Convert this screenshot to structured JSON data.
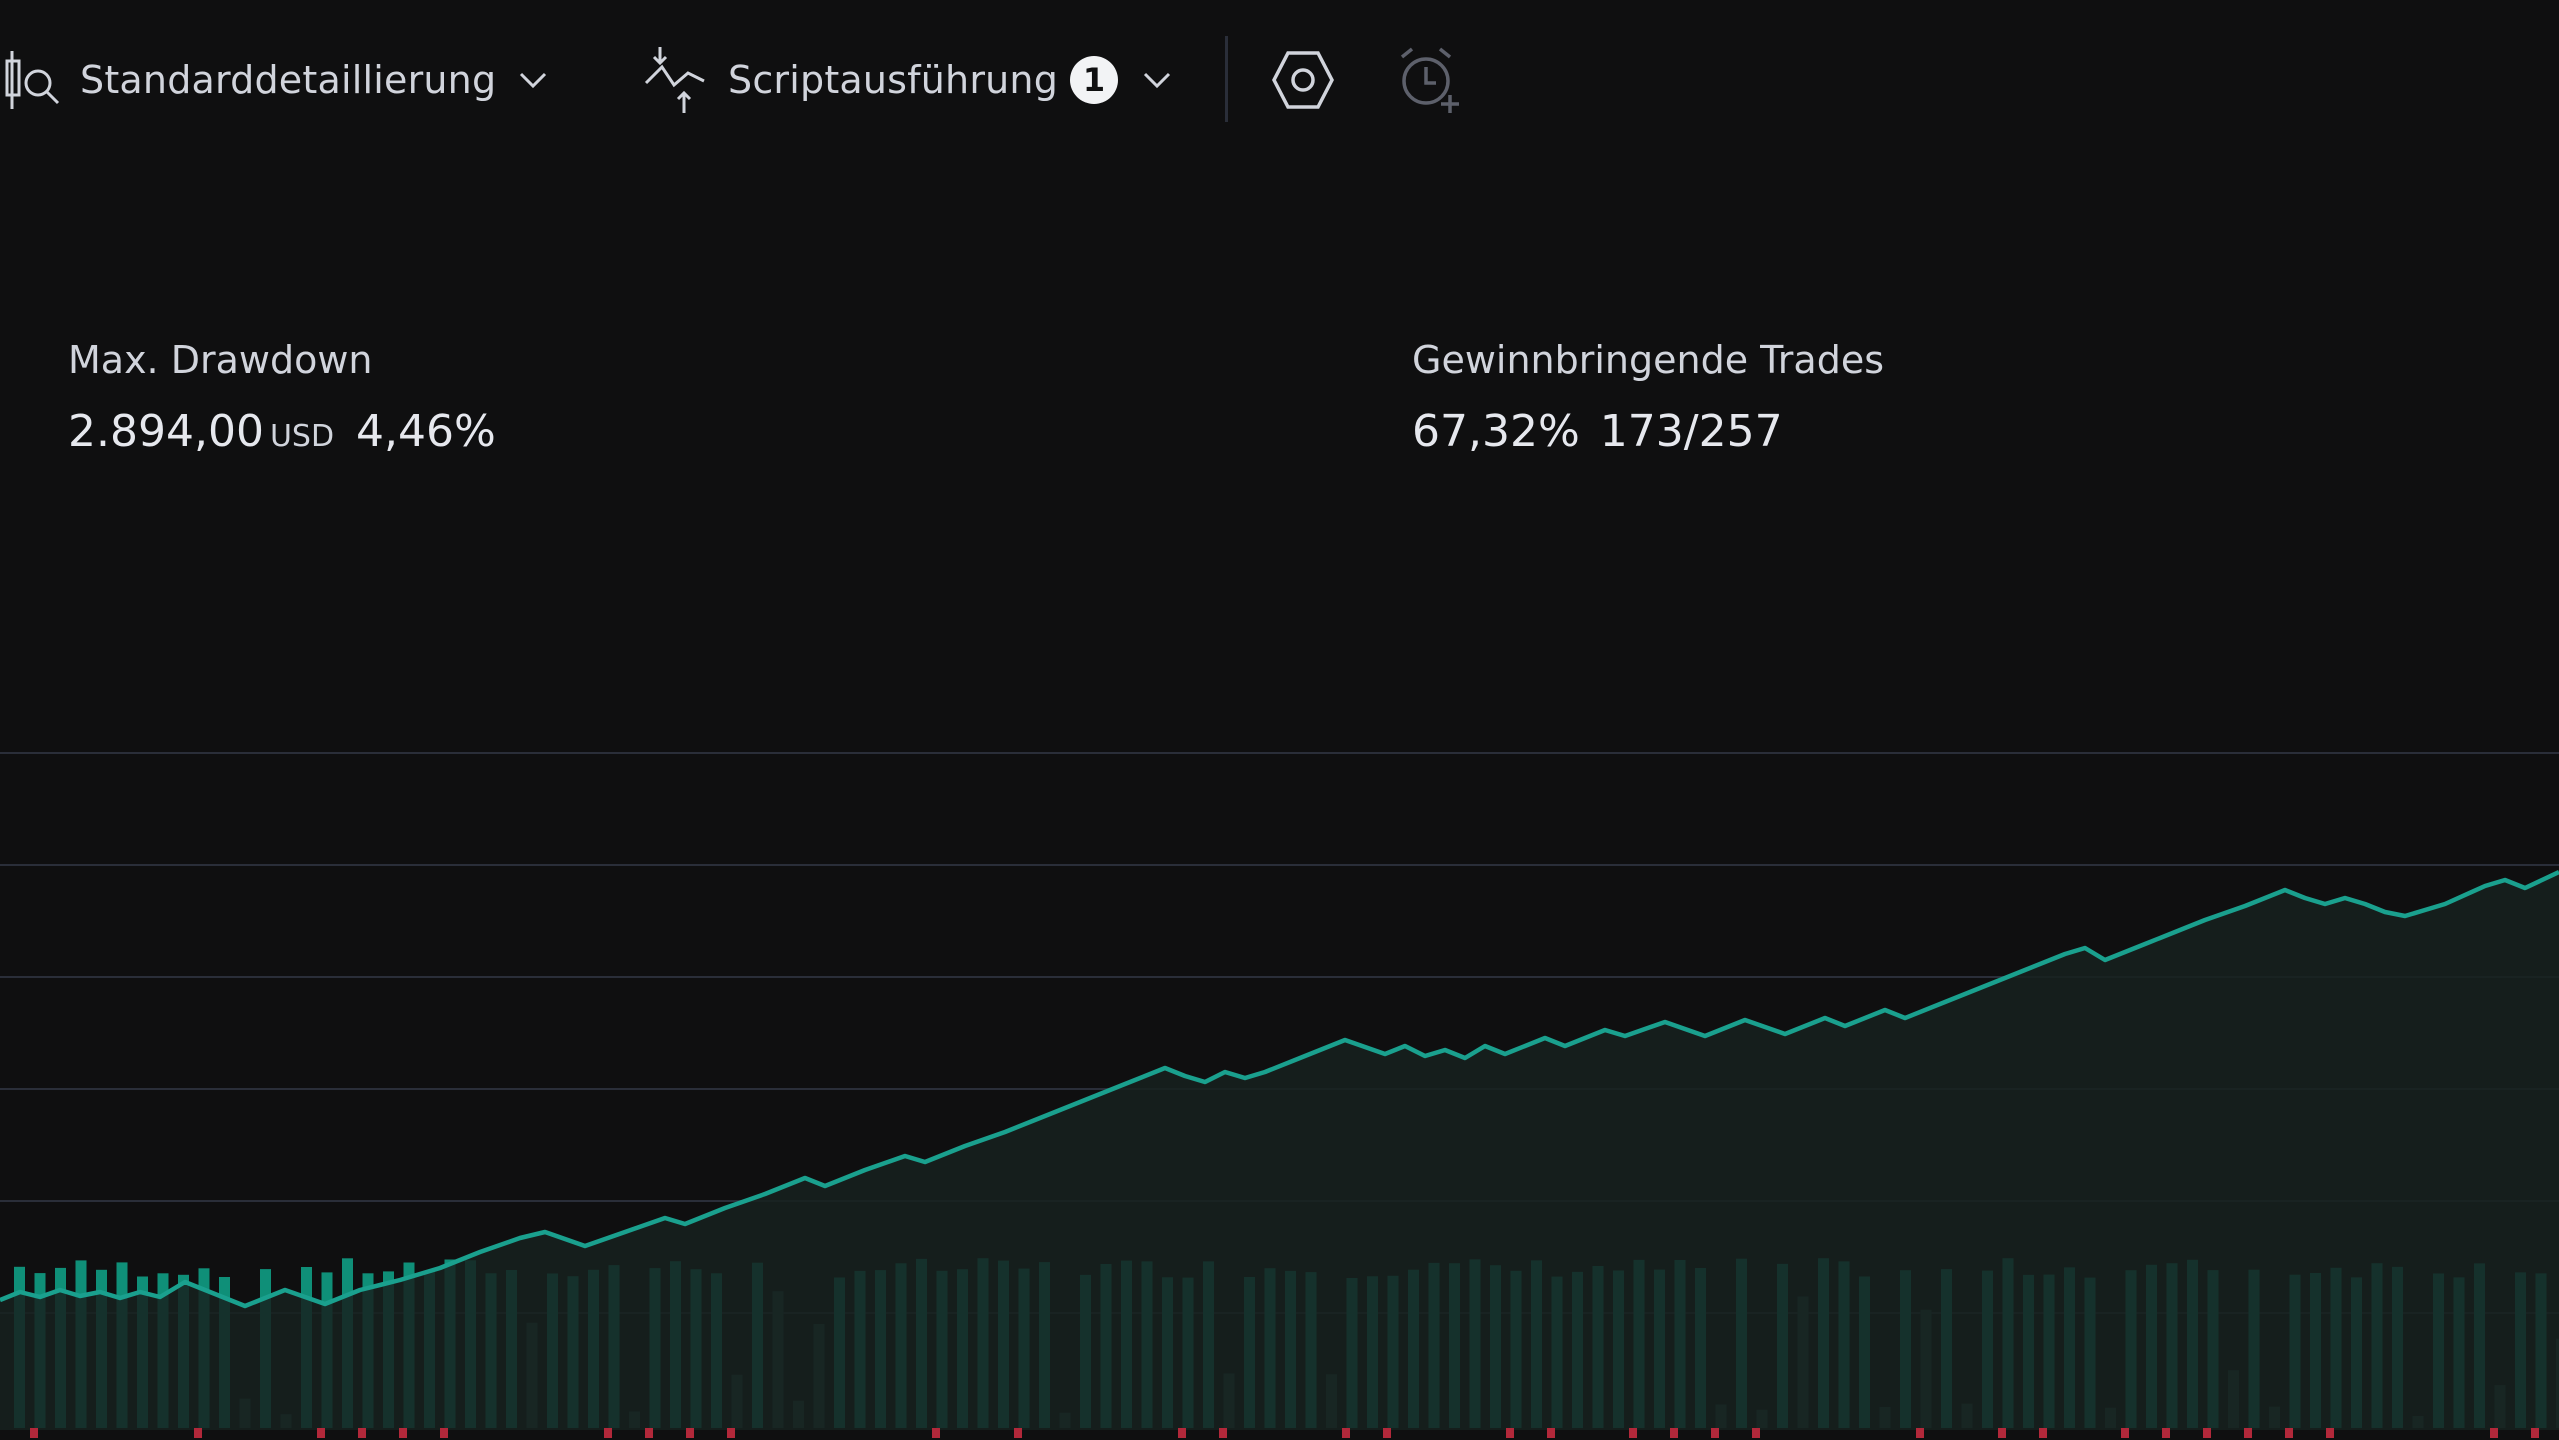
{
  "toolbar": {
    "detail_label": "Standarddetaillierung",
    "script_label": "Scriptausführung",
    "script_badge": "1",
    "icons": [
      "magnifier-chart-icon",
      "chevron-down-icon",
      "script-execution-icon",
      "settings-hexagon-icon",
      "alarm-add-icon"
    ]
  },
  "metrics": {
    "max_drawdown": {
      "title": "Max. Drawdown",
      "value": "2.894,00",
      "unit": "USD",
      "percent": "4,46%"
    },
    "profitable_trades": {
      "title": "Gewinnbringende Trades",
      "percent": "67,32%",
      "ratio": "173/257"
    }
  },
  "colors": {
    "background": "#0f0f10",
    "equity_line": "#1aa08e",
    "bar_profit": "#0f8f78",
    "bar_dim": "#22443d",
    "bar_loss": "#b2283a",
    "grid": "#2a2e39"
  }
}
